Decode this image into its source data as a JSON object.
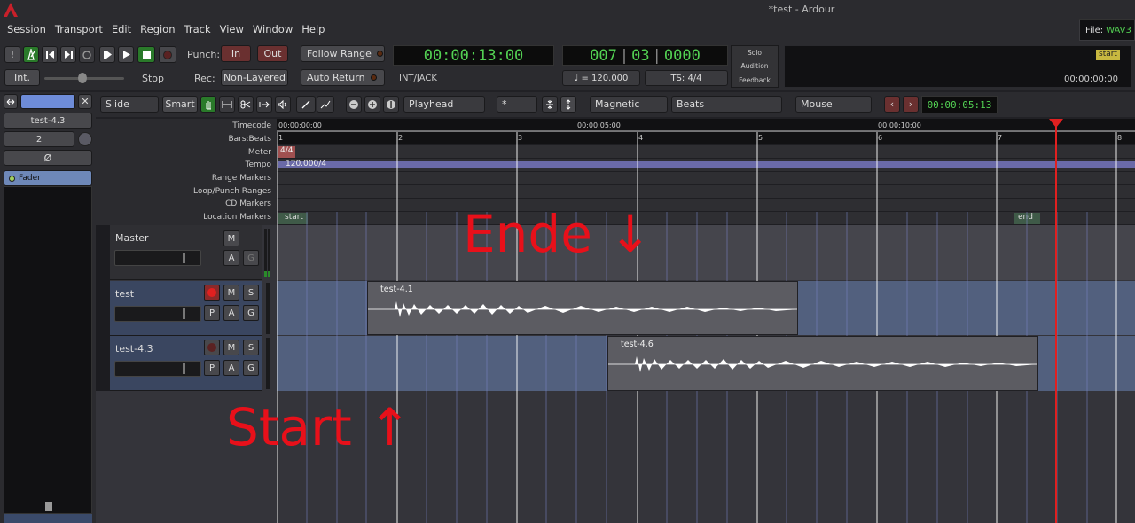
{
  "window": {
    "title": "*test - Ardour"
  },
  "menu": [
    "Session",
    "Transport",
    "Edit",
    "Region",
    "Track",
    "View",
    "Window",
    "Help"
  ],
  "transport": {
    "punch_label": "Punch:",
    "punch_in": "In",
    "punch_out": "Out",
    "rec_label": "Rec:",
    "rec_mode": "Non-Layered",
    "follow_range": "Follow Range",
    "auto_return": "Auto Return",
    "int_label": "Int.",
    "stop_label": "Stop",
    "primary_clock": "00:00:13:00",
    "sync_label": "INT/JACK",
    "bbt_bars": "007",
    "bbt_beats": "03",
    "bbt_ticks": "0000",
    "tempo": "♩ = 120.000",
    "meter": "TS: 4/4",
    "solo": "Solo",
    "audition": "Audition",
    "feedback": "Feedback",
    "file_label": "File:",
    "file_value": "WAV3",
    "mini_marker": "start",
    "mini_time": "00:00:00:00"
  },
  "edit_toolbar": {
    "edit_mode": "Slide",
    "smart": "Smart",
    "zoom_focus": "Playhead",
    "grid_value": "*",
    "snap_mode": "Magnetic",
    "grid_type": "Beats",
    "edit_point": "Mouse",
    "nudge_clock": "00:00:05:13"
  },
  "editor_mixer": {
    "track_name": "test-4.3",
    "input_count": "2",
    "phase": "Ø",
    "fader_label": "Fader"
  },
  "rulers": {
    "labels": [
      "Timecode",
      "Bars:Beats",
      "Meter",
      "Tempo",
      "Range Markers",
      "Loop/Punch Ranges",
      "CD Markers",
      "Location Markers"
    ],
    "timecode_ticks": [
      "00:00:00:00",
      "00:00:05:00",
      "00:00:10:00"
    ],
    "bar_numbers": [
      "1",
      "2",
      "3",
      "4",
      "5",
      "6",
      "7",
      "8"
    ],
    "meter_marker": "4/4",
    "tempo_marker": "120.000/4",
    "start_marker": "start",
    "end_marker": "end"
  },
  "tracks": [
    {
      "name": "Master",
      "buttons": [
        "M",
        "A",
        "G"
      ]
    },
    {
      "name": "test",
      "buttons": [
        "M",
        "S",
        "P",
        "A",
        "G"
      ]
    },
    {
      "name": "test-4.3",
      "buttons": [
        "M",
        "S",
        "P",
        "A",
        "G"
      ]
    }
  ],
  "regions": [
    {
      "name": "test-4.1"
    },
    {
      "name": "test-4.6"
    }
  ],
  "annotations": {
    "ende": "Ende ↓",
    "start": "Start ↑"
  },
  "colors": {
    "clock_green": "#53d153",
    "annotation_red": "#e8101a",
    "playhead": "#e02020",
    "tempo_blue": "#6a6aa8"
  }
}
